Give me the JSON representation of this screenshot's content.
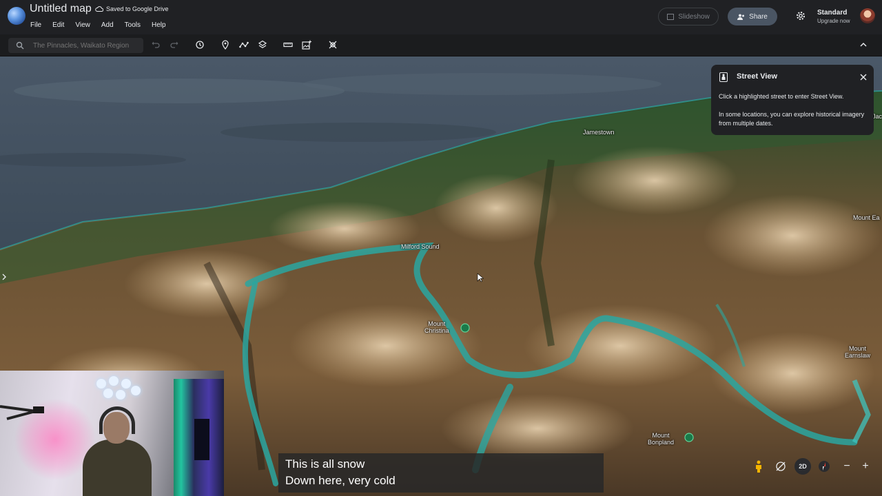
{
  "header": {
    "map_title": "Untitled map",
    "save_status": "Saved to Google Drive",
    "menu": [
      "File",
      "Edit",
      "View",
      "Add",
      "Tools",
      "Help"
    ],
    "slideshow_label": "Slideshow",
    "share_label": "Share",
    "plan_name": "Standard",
    "plan_action": "Upgrade now"
  },
  "toolbar": {
    "search_placeholder": "The Pinnacles, Waikato Region",
    "icons": [
      "undo-icon",
      "redo-icon",
      "history-icon",
      "pin-icon",
      "path-icon",
      "layers-icon",
      "ruler-icon",
      "image-icon",
      "no-pin-icon"
    ]
  },
  "map": {
    "labels": {
      "jamestown": "Jamestown",
      "milford_sound": "Milford Sound",
      "mount_christina_line1": "Mount",
      "mount_christina_line2": "Christina",
      "mount_earnslaw_line1": "Mount",
      "mount_earnslaw_line2": "Earnslaw",
      "mount_bonpland_line1": "Mount",
      "mount_bonpland_line2": "Bonpland",
      "mount_edge": "Mount Ea",
      "edge_label": "Jac"
    }
  },
  "street_view_panel": {
    "title": "Street View",
    "text1": "Click a highlighted street to enter Street View.",
    "text2": "In some locations, you can explore historical imagery from multiple dates."
  },
  "caption": {
    "line1": "This is all snow",
    "line2": "Down here, very cold"
  },
  "map_controls": {
    "view_mode": "2D",
    "zoom_out": "−",
    "zoom_in": "+"
  },
  "colors": {
    "accent_water": "#2aa6a0",
    "header_bg": "#202124",
    "share_bg": "#4a5563"
  }
}
